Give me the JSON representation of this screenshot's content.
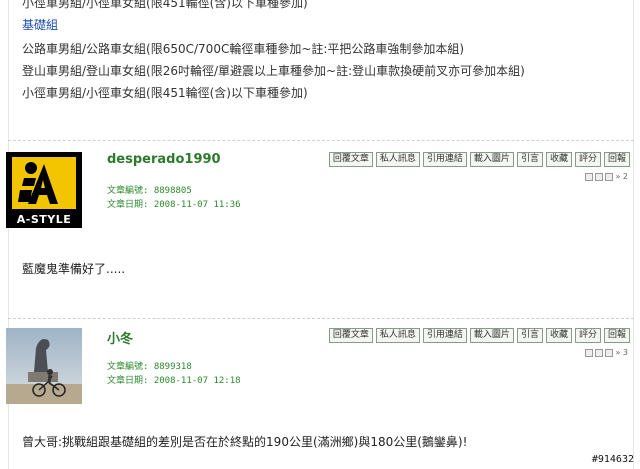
{
  "rules": {
    "top_partial": "小徑車男組/小徑車女組(限451輪徑(含)以下車種參加)",
    "group_label": "基礎組",
    "lines": [
      "公路車男組/公路車女組(限650C/700C輪徑車種參加~註:平把公路車強制參加本組)",
      "登山車男組/登山車女組(限26吋輪徑/單避震以上車種參加~註:登山車款換硬前叉亦可參加本組)",
      "小徑車男組/小徑車女組(限451輪徑(含)以下車種參加)"
    ]
  },
  "actions": [
    "回覆文章",
    "私人訊息",
    "引用連結",
    "載入圖片",
    "引言",
    "收藏",
    "評分",
    "回報"
  ],
  "posts": [
    {
      "username": "desperado1990",
      "article_no": "文章編號: 8898805",
      "article_date": "文章日期: 2008-11-07 11:36",
      "floor": "» 2",
      "body": "藍魔鬼準備好了.....",
      "avatar_text": "A-STYLE"
    },
    {
      "username": "小冬",
      "article_no": "文章編號: 8899318",
      "article_date": "文章日期: 2008-11-07 12:18",
      "floor": "» 3",
      "body": "曾大哥:挑戰組跟基礎組的差別是否在於終點的190公里(滿洲鄉)與180公里(鵝鑾鼻)!"
    }
  ],
  "watermark": "#914632"
}
